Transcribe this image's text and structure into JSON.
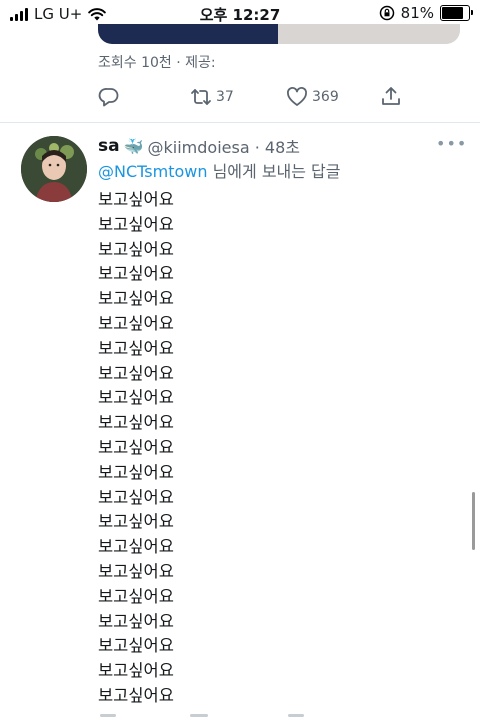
{
  "status_bar": {
    "carrier": "LG U+",
    "time": "오후 12:27",
    "battery_percent": "81%",
    "battery_level": 0.81,
    "icons": [
      "signal-icon",
      "wifi-icon",
      "orientation-lock-icon",
      "battery-icon"
    ]
  },
  "previous_tweet": {
    "views": "조회수 10천 · 제공:",
    "actions": {
      "reply_icon": "reply-icon",
      "retweet_count": "37",
      "like_count": "369",
      "share_icon": "share-icon"
    }
  },
  "tweet": {
    "display_name": "sa",
    "name_emoji": "🐳",
    "handle_time": "@kiimdoiesa · 48초",
    "reply_mention": "@NCTsmtown",
    "reply_suffix": " 님에게 보내는 답글",
    "more_icon": "more-icon",
    "lines": [
      "보고싶어요",
      "보고싶어요",
      "보고싶어요",
      "보고싶어요",
      "보고싶어요",
      "보고싶어요",
      "보고싶어요",
      "보고싶어요",
      "보고싶어요",
      "보고싶어요",
      "보고싶어요",
      "보고싶어요",
      "보고싶어요",
      "보고싶어요",
      "보고싶어요",
      "보고싶어요",
      "보고싶어요",
      "보고싶어요",
      "보고싶어요",
      "보고싶어요",
      "보고싶어요"
    ]
  },
  "colors": {
    "link": "#1b95e0",
    "secondary_text": "#5b6570",
    "divider": "#e1e8ed"
  }
}
